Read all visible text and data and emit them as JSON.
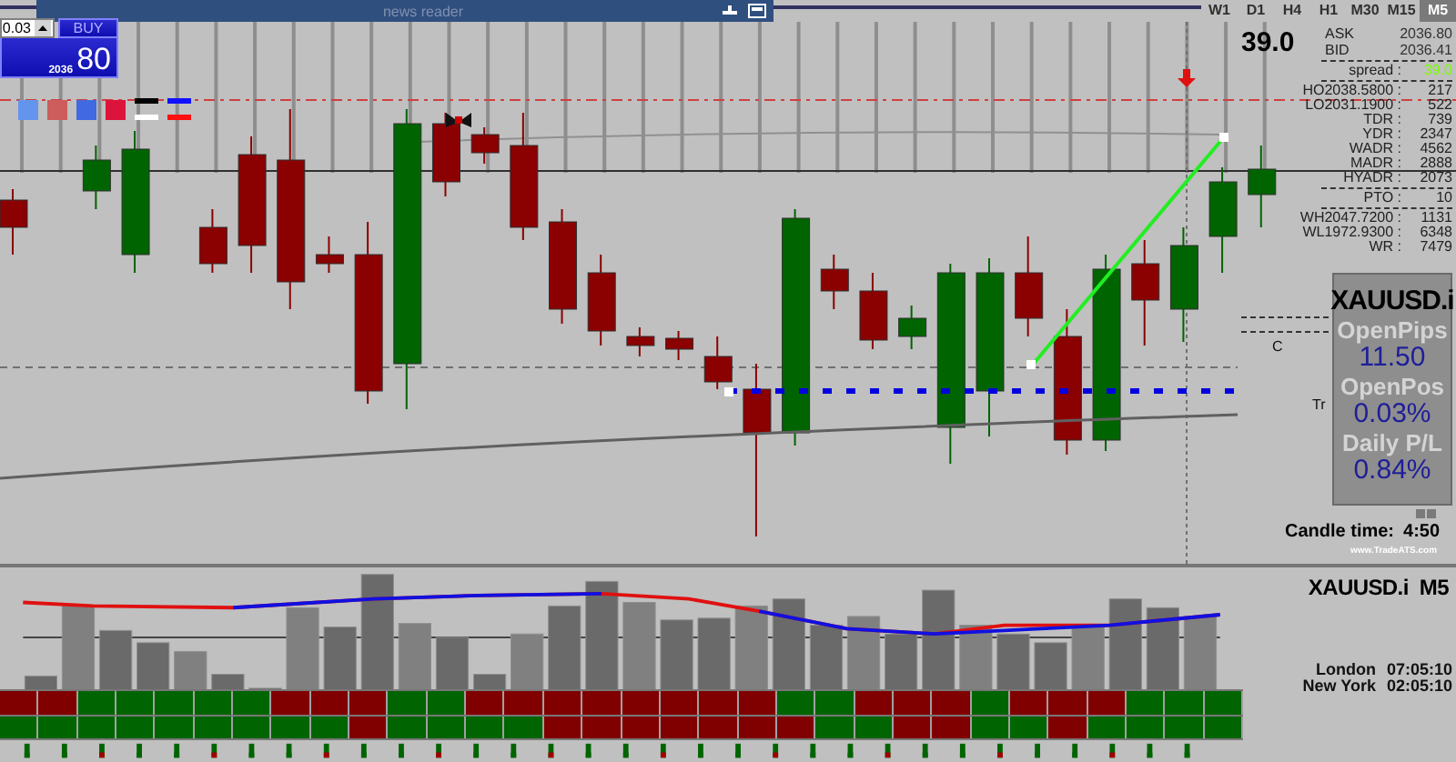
{
  "news_reader": {
    "title": "news reader"
  },
  "trade_widget": {
    "lot_size": "0.03",
    "buy": {
      "label": "BUY",
      "price_small": "2036",
      "price_big": "80"
    },
    "swatches": [
      {
        "color": "#6495ed"
      },
      {
        "color": "#cd5c5c"
      },
      {
        "color": "#4169e1"
      },
      {
        "color": "#dc143c"
      }
    ]
  },
  "timeframes": [
    {
      "label": "W1",
      "selected": false
    },
    {
      "label": "D1",
      "selected": false
    },
    {
      "label": "H4",
      "selected": false
    },
    {
      "label": "H1",
      "selected": false
    },
    {
      "label": "M30",
      "selected": false
    },
    {
      "label": "M15",
      "selected": false
    },
    {
      "label": "M5",
      "selected": true
    }
  ],
  "info": {
    "spread_big": "39.0",
    "ask_label": "ASK",
    "ask": "2036.80",
    "bid_label": "BID",
    "bid": "2036.41",
    "spread_label": "spread :",
    "spread": "39.0",
    "stat_groups": [
      [
        {
          "label": "HO",
          "price": "2038.5800 :",
          "value": "217"
        },
        {
          "label": "LO",
          "price": "2031.1900 :",
          "value": "522"
        },
        {
          "label": "TDR :",
          "value": "739"
        },
        {
          "label": "YDR :",
          "value": "2347"
        },
        {
          "label": "WADR :",
          "value": "4562"
        },
        {
          "label": "MADR :",
          "value": "2888"
        },
        {
          "label": "HYADR :",
          "value": "2073"
        }
      ],
      [
        {
          "label": "PTO :",
          "value": "10"
        }
      ],
      [
        {
          "label": "WH",
          "price": "2047.7200 :",
          "value": "1131"
        },
        {
          "label": "WL",
          "price": "1972.9300 :",
          "value": "6348"
        },
        {
          "label": "WR :",
          "value": "7479"
        }
      ]
    ]
  },
  "partial_labels": [
    "C",
    "Tr"
  ],
  "position_box": {
    "symbol": "XAUUSD.i",
    "items": [
      {
        "label": "OpenPips",
        "value": "11.50"
      },
      {
        "label": "OpenPos",
        "value": "0.03%"
      },
      {
        "label": "Daily P/L",
        "value": "0.84%"
      }
    ]
  },
  "candle_time": {
    "label": "Candle time:",
    "value": "4:50"
  },
  "credit": "www.TradeATS.com",
  "indicator": {
    "title": "XAUUSD.i  M5",
    "sessions": [
      {
        "city": "London",
        "time": "07:05:10"
      },
      {
        "city": "New York",
        "time": "02:05:10"
      }
    ],
    "rows": [
      [
        {
          "color": "#800000"
        },
        {
          "color": "#800000"
        },
        {
          "color": "#006400"
        },
        {
          "color": "#006400"
        },
        {
          "color": "#006400"
        },
        {
          "color": "#006400"
        },
        {
          "color": "#006400"
        },
        {
          "color": "#800000"
        },
        {
          "color": "#800000"
        },
        {
          "color": "#800000"
        },
        {
          "color": "#006400"
        },
        {
          "color": "#006400"
        },
        {
          "color": "#800000"
        },
        {
          "color": "#800000"
        },
        {
          "color": "#800000"
        },
        {
          "color": "#800000"
        },
        {
          "color": "#800000"
        },
        {
          "color": "#800000"
        },
        {
          "color": "#800000"
        },
        {
          "color": "#800000"
        },
        {
          "color": "#006400"
        },
        {
          "color": "#006400"
        },
        {
          "color": "#800000"
        },
        {
          "color": "#800000"
        },
        {
          "color": "#800000"
        },
        {
          "color": "#006400"
        },
        {
          "color": "#800000"
        },
        {
          "color": "#800000"
        },
        {
          "color": "#800000"
        },
        {
          "color": "#006400"
        },
        {
          "color": "#006400"
        },
        {
          "color": "#006400"
        }
      ],
      [
        {
          "color": "#006400"
        },
        {
          "color": "#006400"
        },
        {
          "color": "#006400"
        },
        {
          "color": "#006400"
        },
        {
          "color": "#006400"
        },
        {
          "color": "#006400"
        },
        {
          "color": "#006400"
        },
        {
          "color": "#006400"
        },
        {
          "color": "#006400"
        },
        {
          "color": "#800000"
        },
        {
          "color": "#006400"
        },
        {
          "color": "#006400"
        },
        {
          "color": "#006400"
        },
        {
          "color": "#006400"
        },
        {
          "color": "#800000"
        },
        {
          "color": "#800000"
        },
        {
          "color": "#800000"
        },
        {
          "color": "#800000"
        },
        {
          "color": "#800000"
        },
        {
          "color": "#800000"
        },
        {
          "color": "#800000"
        },
        {
          "color": "#006400"
        },
        {
          "color": "#006400"
        },
        {
          "color": "#800000"
        },
        {
          "color": "#800000"
        },
        {
          "color": "#006400"
        },
        {
          "color": "#006400"
        },
        {
          "color": "#800000"
        },
        {
          "color": "#006400"
        },
        {
          "color": "#006400"
        },
        {
          "color": "#006400"
        },
        {
          "color": "#006400"
        }
      ]
    ]
  }
}
